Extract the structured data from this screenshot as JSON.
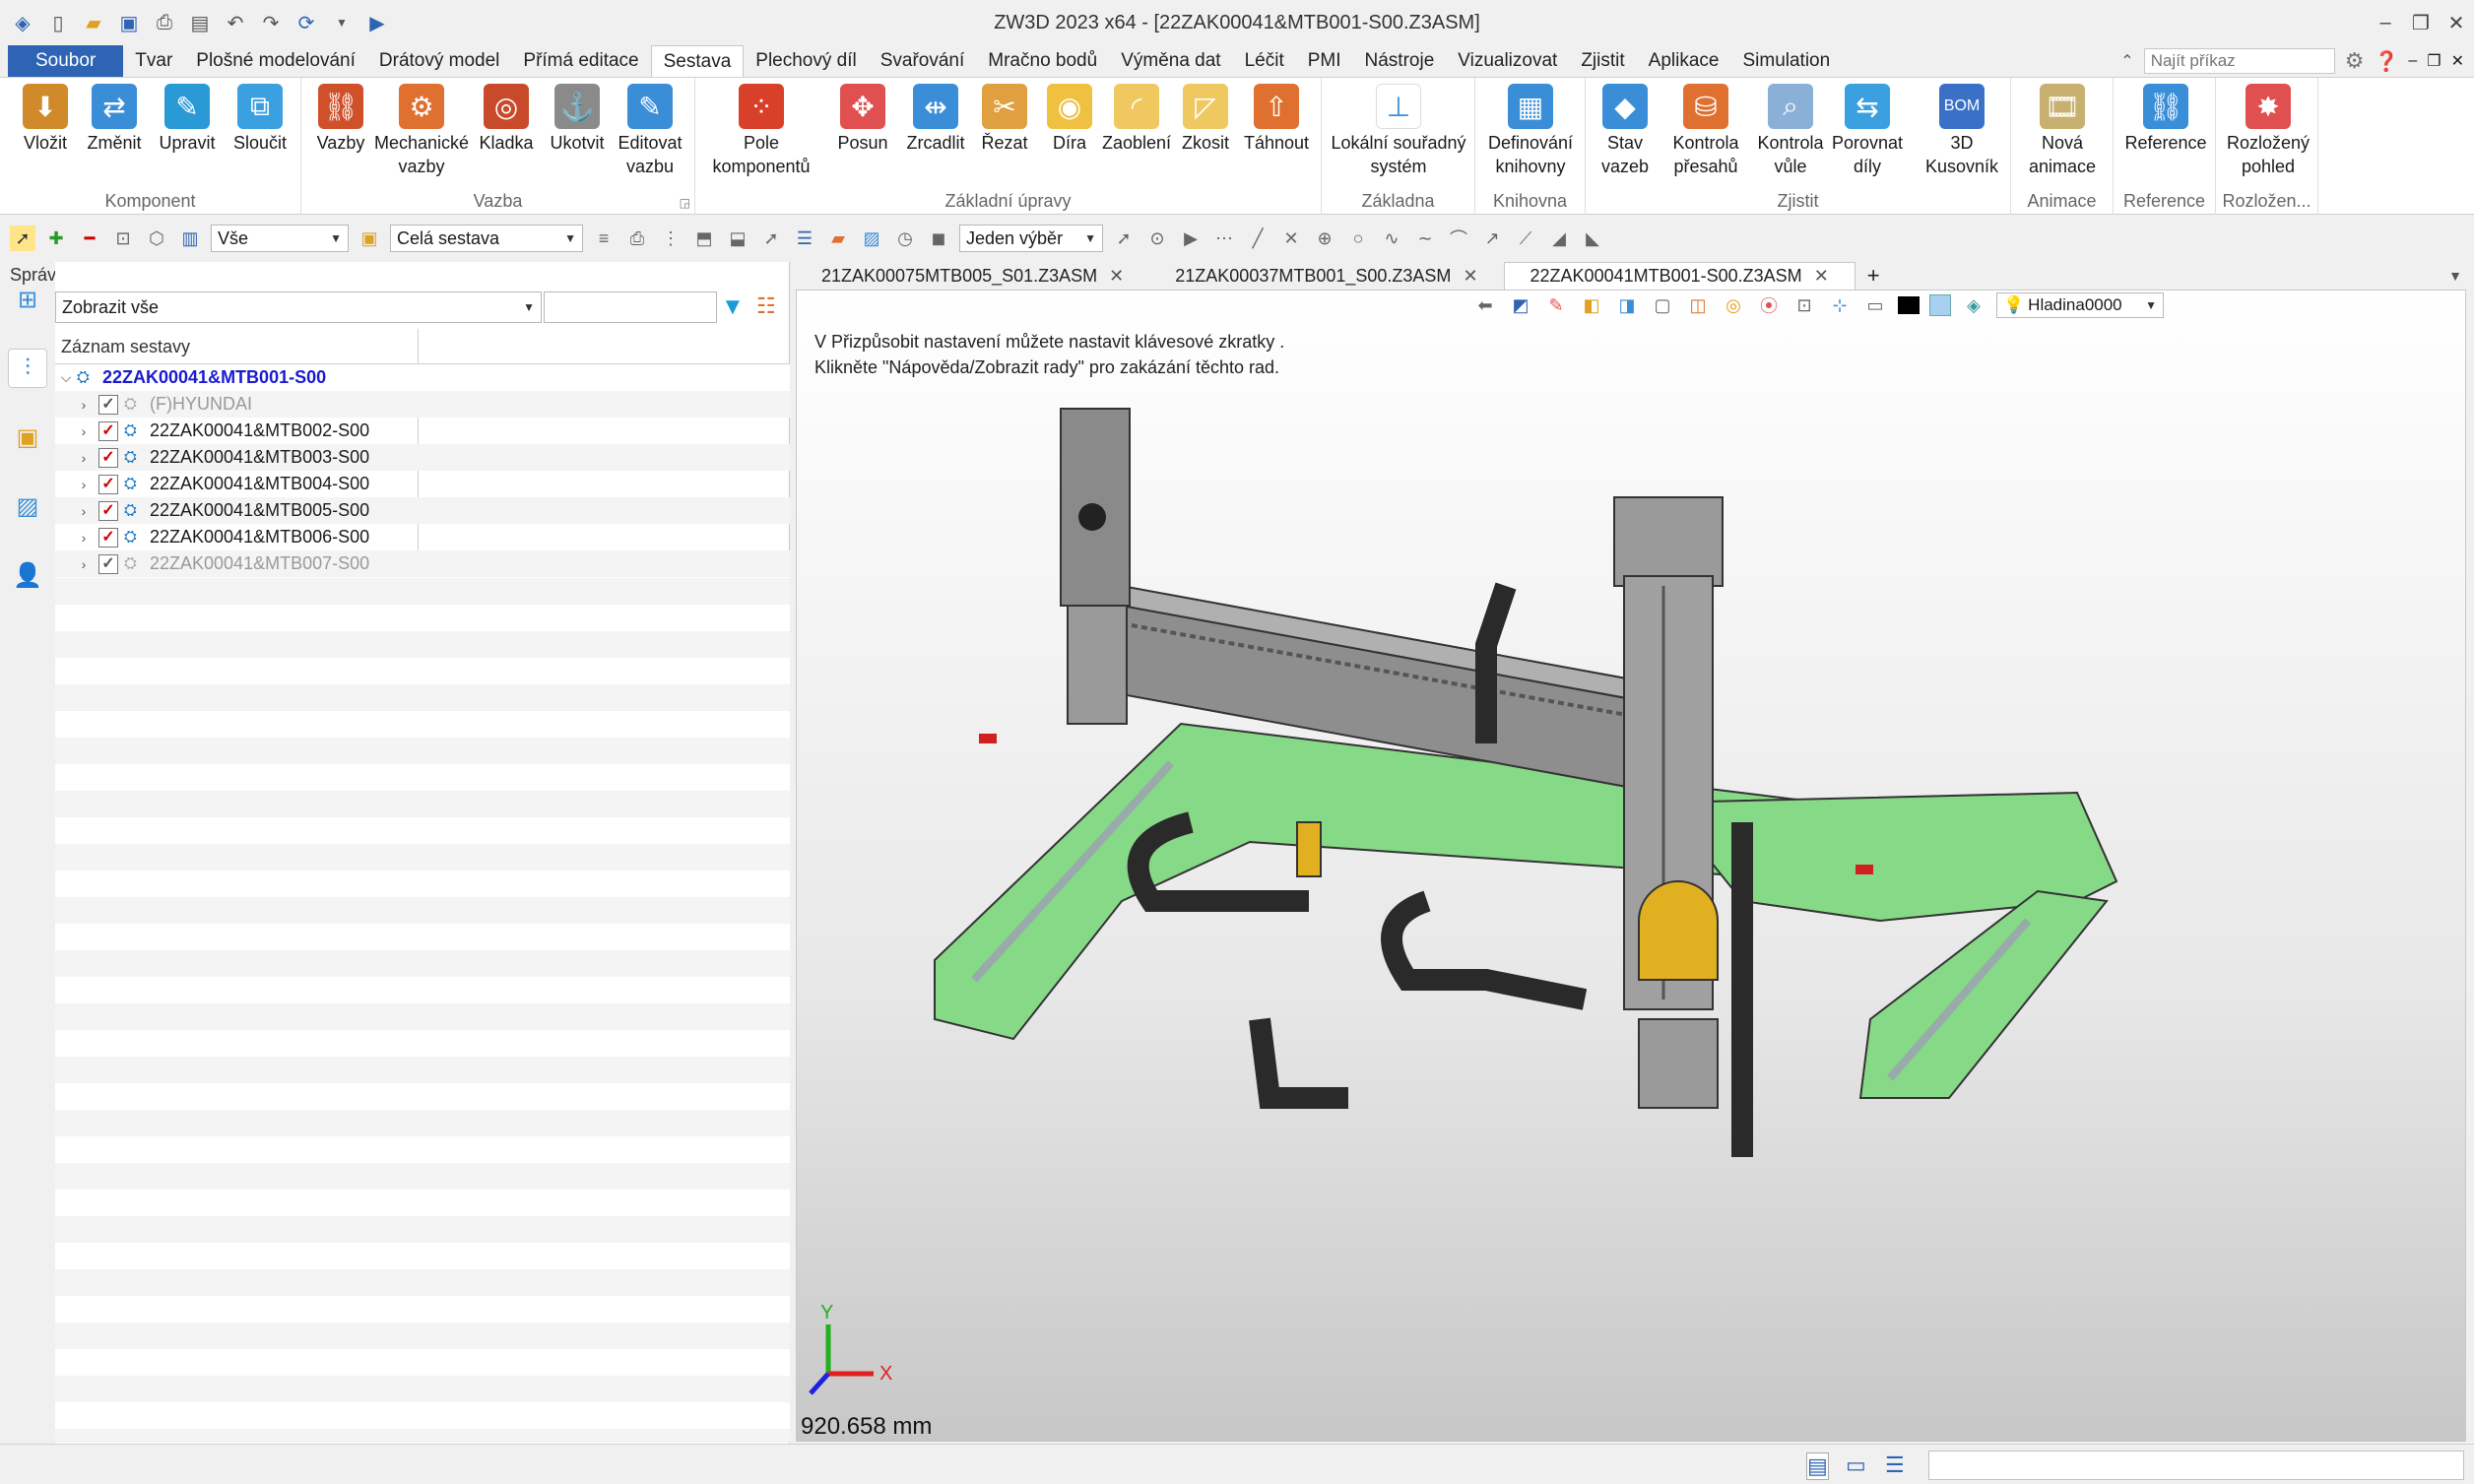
{
  "title": "ZW3D 2023 x64 - [22ZAK00041&MTB001-S00.Z3ASM]",
  "menu": {
    "file": "Soubor",
    "tabs": [
      "Tvar",
      "Plošné modelování",
      "Drátový model",
      "Přímá editace",
      "Sestava",
      "Plechový díl",
      "Svařování",
      "Mračno bodů",
      "Výměna dat",
      "Léčit",
      "PMI",
      "Nástroje",
      "Vizualizovat",
      "Zjistit",
      "Aplikace",
      "Simulation"
    ],
    "active": "Sestava",
    "search_placeholder": "Najít příkaz"
  },
  "ribbon": {
    "groups": [
      {
        "label": "Komponent",
        "buttons": [
          "Vložit",
          "Změnit",
          "Upravit",
          "Sloučit"
        ]
      },
      {
        "label": "Vazba",
        "buttons": [
          "Vazby",
          "Mechanické\nvazby",
          "Kladka",
          "Ukotvit",
          "Editovat\nvazbu"
        ]
      },
      {
        "label": "Základní úpravy",
        "buttons": [
          "Pole\nkomponentů",
          "Posun",
          "Zrcadlit",
          "Řezat",
          "Díra",
          "Zaoblení",
          "Zkosit",
          "Táhnout"
        ]
      },
      {
        "label": "Základna",
        "buttons": [
          "Lokální souřadný\nsystém"
        ]
      },
      {
        "label": "Knihovna",
        "buttons": [
          "Definování\nknihovny"
        ]
      },
      {
        "label": "Zjistit",
        "buttons": [
          "Stav\nvazeb",
          "Kontrola\npřesahů",
          "Kontrola\nvůle",
          "Porovnat\ndíly",
          "3D\nKusovník"
        ]
      },
      {
        "label": "Animace",
        "buttons": [
          "Nová\nanimace"
        ]
      },
      {
        "label": "Reference",
        "buttons": [
          "Reference"
        ]
      },
      {
        "label": "Rozložen...",
        "buttons": [
          "Rozložený\npohled"
        ]
      }
    ]
  },
  "toolbar": {
    "filter": "Vše",
    "scope": "Celá sestava",
    "selection": "Jeden výběr"
  },
  "panel": {
    "title": "Správce",
    "display": "Zobrazit vše",
    "header": "Záznam sestavy",
    "root": "22ZAK00041&MTB001-S00",
    "items": [
      {
        "label": "(F)HYUNDAI",
        "checked": false,
        "dim": true
      },
      {
        "label": "22ZAK00041&MTB002-S00",
        "checked": true,
        "dim": false
      },
      {
        "label": "22ZAK00041&MTB003-S00",
        "checked": true,
        "dim": false
      },
      {
        "label": "22ZAK00041&MTB004-S00",
        "checked": true,
        "dim": false
      },
      {
        "label": "22ZAK00041&MTB005-S00",
        "checked": true,
        "dim": false
      },
      {
        "label": "22ZAK00041&MTB006-S00",
        "checked": true,
        "dim": false
      },
      {
        "label": "22ZAK00041&MTB007-S00",
        "checked": false,
        "dim": true
      }
    ]
  },
  "doc_tabs": [
    "21ZAK00075MTB005_S01.Z3ASM",
    "21ZAK00037MTB001_S00.Z3ASM",
    "22ZAK00041MTB001-S00.Z3ASM"
  ],
  "active_doc": 2,
  "viewport": {
    "hint1": "V Přizpůsobit nastavení můžete nastavit klávesové zkratky .",
    "hint2": "Klikněte \"Nápověda/Zobrazit rady\" pro zakázání těchto rad.",
    "layer": "Hladina0000",
    "scale": "920.658 mm",
    "axis_x": "X",
    "axis_y": "Y"
  },
  "colors": {
    "accent": "#2f64b5",
    "frame": "#7fd47f",
    "part": "#8c8c8c",
    "yellow": "#e0b020"
  }
}
